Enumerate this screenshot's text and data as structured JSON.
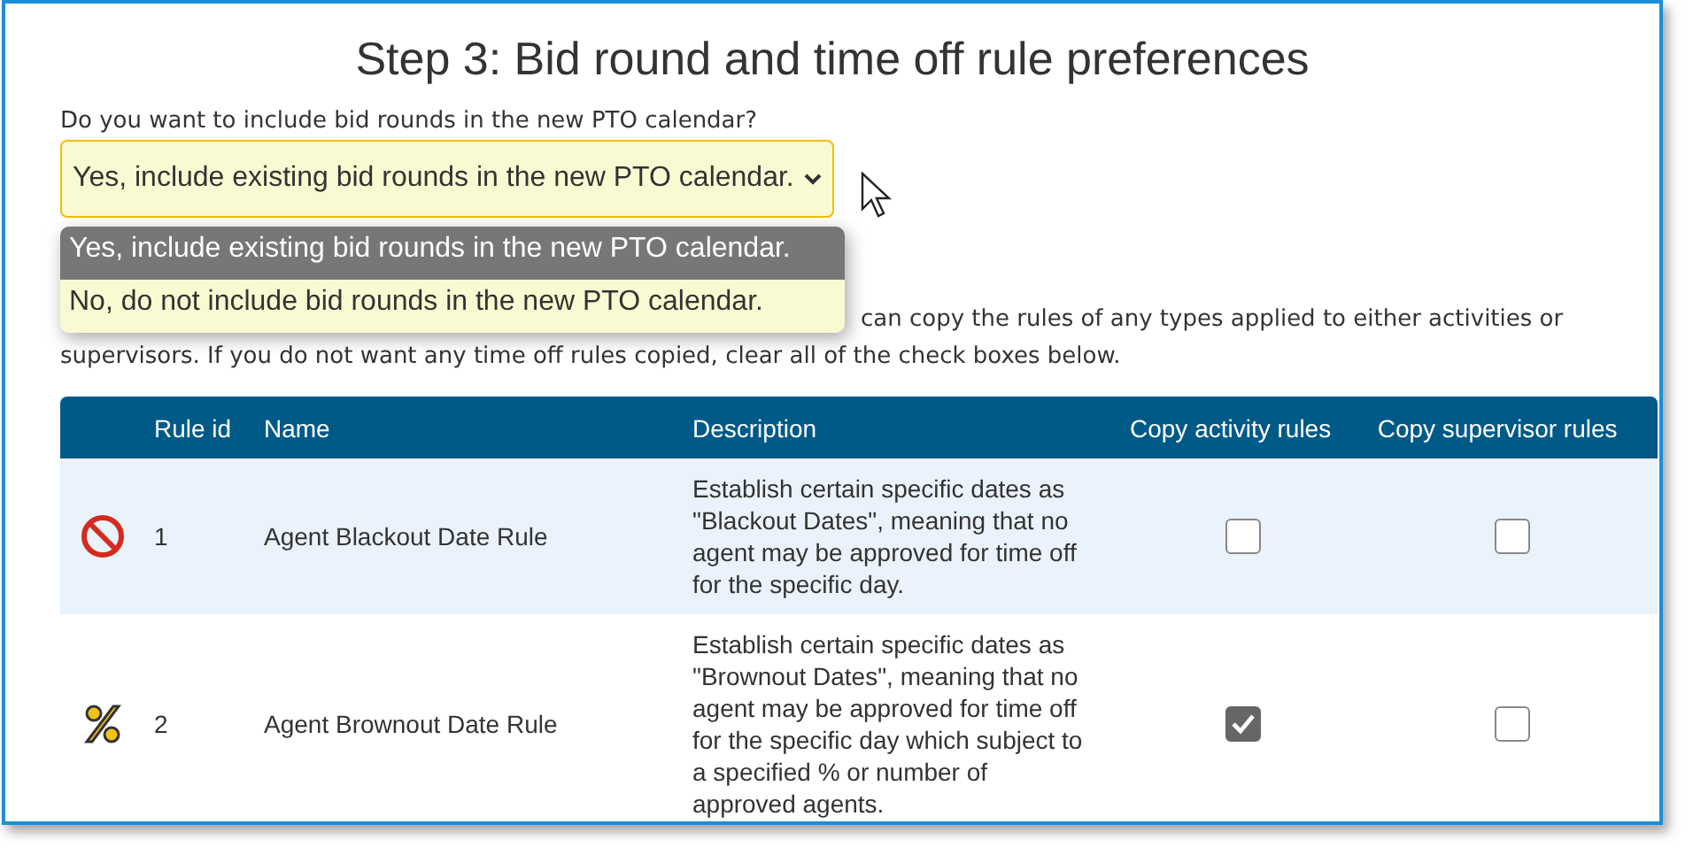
{
  "title": "Step 3: Bid round and time off rule preferences",
  "question": "Do you want to include bid rounds in the new PTO calendar?",
  "select": {
    "value": "Yes, include existing bid rounds in the new PTO calendar.",
    "options": [
      {
        "label": "Yes, include existing bid rounds in the new PTO calendar.",
        "selected": true
      },
      {
        "label": "No, do not include bid rounds in the new PTO calendar.",
        "selected": false
      }
    ]
  },
  "paragraph": [
    "can copy the rules of any types applied to either activities or",
    "supervisors. If you do not want any time off rules copied, clear all of the check boxes below."
  ],
  "table": {
    "columns": [
      "",
      "Rule id",
      "Name",
      "Description",
      "Copy activity rules",
      "Copy supervisor rules"
    ],
    "rows": [
      {
        "id": "1",
        "name": "Agent Blackout Date Rule",
        "description": "Establish certain specific dates as \"Blackout Dates\", meaning that no agent may be approved for time off for the specific day.",
        "copy_activity": false,
        "copy_supervisor": false
      },
      {
        "id": "2",
        "name": "Agent Brownout Date Rule",
        "description": "Establish certain specific dates as \"Brownout Dates\", meaning that no agent may be approved for time off for the specific day which subject to a specified % or number of approved agents.",
        "copy_activity": true,
        "copy_supervisor": false
      }
    ]
  }
}
